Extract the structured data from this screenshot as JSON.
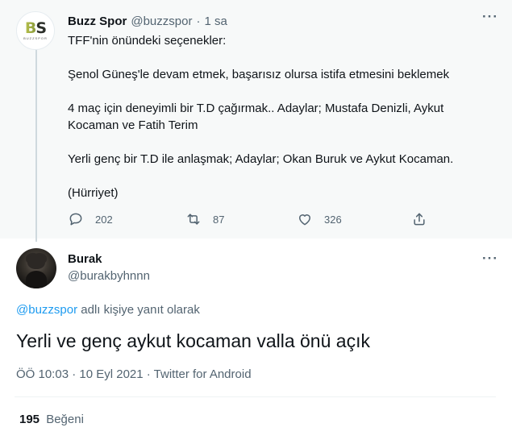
{
  "parent": {
    "author_name": "Buzz Spor",
    "author_handle": "@buzzspor",
    "separator": "·",
    "time": "1 sa",
    "avatar_text": "BS",
    "avatar_subtext": "BUZZSPOR",
    "paragraphs": [
      "TFF'nin önündeki seçenekler:",
      "Şenol Güneş'le devam etmek, başarısız olursa istifa etmesini beklemek",
      "4 maç için deneyimli bir T.D çağırmak.. Adaylar; Mustafa Denizli, Aykut Kocaman ve Fatih Terim",
      "Yerli genç bir T.D ile anlaşmak; Adaylar; Okan Buruk ve Aykut Kocaman.",
      "(Hürriyet)"
    ],
    "reply_count": "202",
    "retweet_count": "87",
    "like_count": "326",
    "icons": [
      "reply-icon",
      "retweet-icon",
      "like-icon",
      "share-icon",
      "more-icon"
    ]
  },
  "reply": {
    "author_name": "Burak",
    "author_handle": "@burakbyhnnn",
    "reply_to_mention": "@buzzspor",
    "reply_to_suffix": "adlı kişiye yanıt olarak",
    "text": "Yerli ve genç aykut kocaman valla önü açık",
    "meta": "ÖÖ 10:03 · 10 Eyl 2021 · Twitter for Android",
    "likes_count": "195",
    "likes_label": "Beğeni"
  },
  "colors": {
    "accent": "#1d9bf0",
    "secondary_text": "#536471",
    "parent_bg": "#f7f9f9",
    "thread_line": "#cfd9de"
  }
}
